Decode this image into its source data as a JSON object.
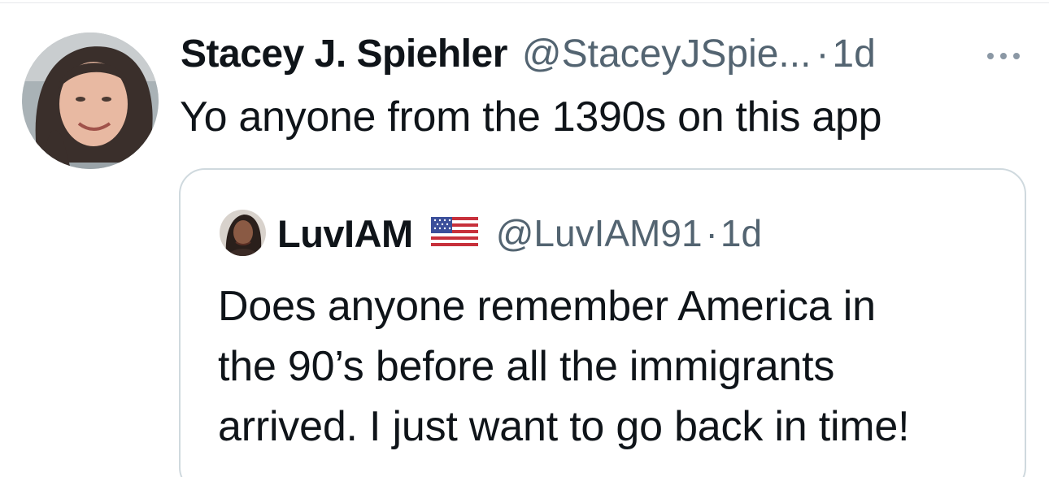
{
  "tweet": {
    "author_name": "Stacey J. Spiehler",
    "author_handle": "@StaceyJSpie...",
    "separator": "·",
    "time": "1d",
    "text": "Yo anyone from the 1390s on this app",
    "avatar_icon": "user-avatar-photo",
    "more_icon": "more-options-icon"
  },
  "quoted_tweet": {
    "author_name": "LuvIAM",
    "flag_icon": "us-flag-icon",
    "author_handle": "@LuvIAM91",
    "separator": "·",
    "time": "1d",
    "text_lines": [
      "Does anyone remember America in",
      "the 90’s before all the immigrants",
      "arrived. I just want to go back in time!"
    ]
  },
  "colors": {
    "text_primary": "#0f1419",
    "text_secondary": "#536471",
    "border": "#cfd9de"
  }
}
